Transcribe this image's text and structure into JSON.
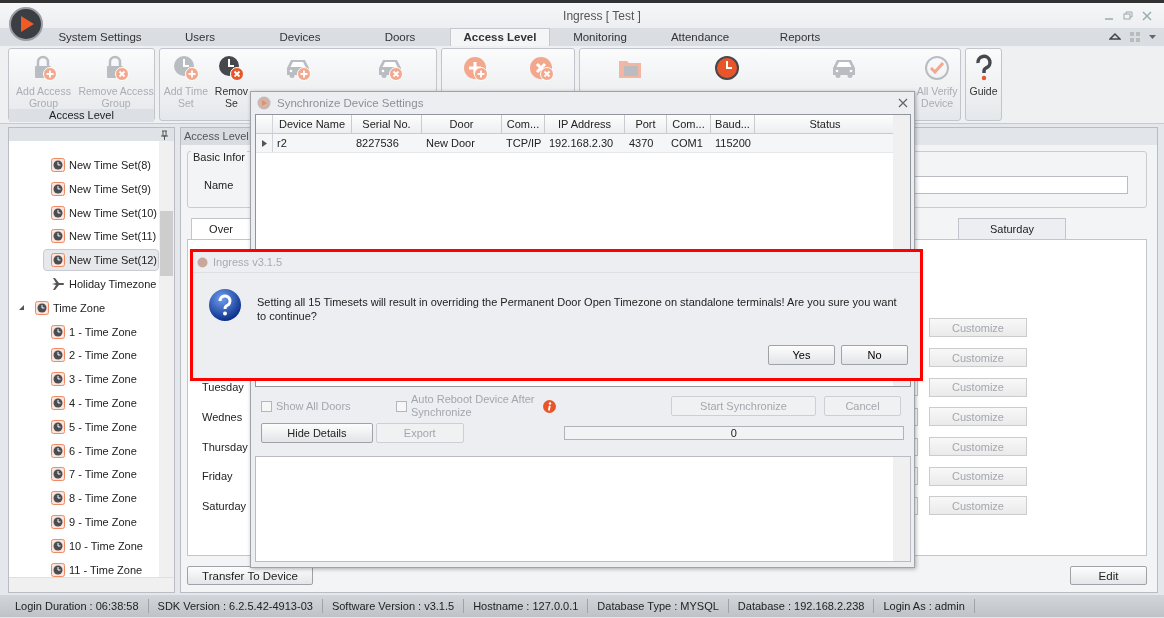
{
  "window": {
    "title": "Ingress [ Test ]"
  },
  "tabs": [
    {
      "label": "System Settings",
      "selected": false
    },
    {
      "label": "Users",
      "selected": false
    },
    {
      "label": "Devices",
      "selected": false
    },
    {
      "label": "Doors",
      "selected": false
    },
    {
      "label": "Access Level",
      "selected": true
    },
    {
      "label": "Monitoring",
      "selected": false
    },
    {
      "label": "Attendance",
      "selected": false
    },
    {
      "label": "Reports",
      "selected": false
    }
  ],
  "ribbon": {
    "groups": [
      {
        "label": "Access Level",
        "buttons": [
          {
            "kind": "addgroup",
            "lines": [
              "Add Access",
              "Group"
            ],
            "disabled": true
          },
          {
            "kind": "removegroup",
            "lines": [
              "Remove Access",
              "Group"
            ],
            "disabled": true
          }
        ]
      },
      {
        "buttons": [
          {
            "kind": "addtimeset",
            "lines": [
              "Add Time",
              "Set"
            ],
            "disabled": true
          },
          {
            "kind": "removetimeset",
            "lines": [
              "Remov",
              "Se"
            ],
            "disabled": false
          },
          {
            "kind": "addholiday",
            "disabled": true
          },
          {
            "kind": "removeholiday",
            "disabled": true
          }
        ]
      },
      {
        "buttons": [
          {
            "kind": "addverify",
            "disabled": true
          },
          {
            "kind": "removeverify",
            "disabled": true
          }
        ]
      },
      {
        "buttons": [
          {
            "kind": "transferholiday",
            "disabled": true
          },
          {
            "kind": "transfertimes",
            "disabled": false
          },
          {
            "kind": "transferholidays",
            "disabled": true
          },
          {
            "kind": "transferverify",
            "lines": [
              "All Verify",
              "Device"
            ],
            "disabled": true
          }
        ]
      },
      {
        "buttons": [
          {
            "kind": "guide",
            "lines": [
              "Guide"
            ],
            "disabled": false
          }
        ]
      }
    ]
  },
  "tree": {
    "items": [
      {
        "kind": "clock",
        "label": "New Time Set(8)",
        "selected": false
      },
      {
        "kind": "clock",
        "label": "New Time Set(9)",
        "selected": false
      },
      {
        "kind": "clock",
        "label": "New Time Set(10)",
        "selected": false
      },
      {
        "kind": "clock",
        "label": "New Time Set(11)",
        "selected": false
      },
      {
        "kind": "clock",
        "label": "New Time Set(12)",
        "selected": true
      },
      {
        "kind": "holiday",
        "label": "Holiday Timezone",
        "selected": false
      },
      {
        "kind": "clock",
        "label": "Time Zone",
        "selected": false,
        "expanded": true,
        "children": [
          {
            "kind": "clock",
            "label": "1 - Time Zone",
            "selected": false
          },
          {
            "kind": "clock",
            "label": "2 - Time Zone",
            "selected": false
          },
          {
            "kind": "clock",
            "label": "3 - Time Zone",
            "selected": false
          },
          {
            "kind": "clock",
            "label": "4 - Time Zone",
            "selected": false
          },
          {
            "kind": "clock",
            "label": "5 - Time Zone",
            "selected": false
          },
          {
            "kind": "clock",
            "label": "6 - Time Zone",
            "selected": false
          },
          {
            "kind": "clock",
            "label": "7 - Time Zone",
            "selected": false
          },
          {
            "kind": "clock",
            "label": "8 - Time Zone",
            "selected": false
          },
          {
            "kind": "clock",
            "label": "9 - Time Zone",
            "selected": false
          },
          {
            "kind": "clock",
            "label": "10 - Time Zone",
            "selected": false
          },
          {
            "kind": "clock",
            "label": "11 - Time Zone",
            "selected": false
          }
        ]
      }
    ]
  },
  "content": {
    "header": "Access Level",
    "legend": "Basic Infor",
    "name_label": "Name",
    "day_tabs": [
      {
        "label": "Over",
        "selected": true
      },
      {
        "label": "Saturday",
        "selected": false
      }
    ],
    "day_rows": [
      {
        "button": "Customize"
      },
      {
        "button": "Customize"
      },
      {
        "label": "Tuesday",
        "button": "Customize"
      },
      {
        "label": "Wednes",
        "button": "Customize"
      },
      {
        "label": "Thursday",
        "button": "Customize"
      },
      {
        "label": "Friday",
        "button": "Customize"
      },
      {
        "label": "Saturday",
        "button": "Customize"
      }
    ],
    "transfer_button": "Transfer To Device",
    "edit_button": "Edit"
  },
  "sync_dialog": {
    "title": "Synchronize Device Settings",
    "columns": [
      "Device Name",
      "Serial No.",
      "Door",
      "Com...",
      "IP Address",
      "Port",
      "Com...",
      "Baud...",
      "Status"
    ],
    "rows": [
      {
        "cells": [
          "r2",
          "8227536",
          "New Door",
          "TCP/IP",
          "192.168.2.30",
          "4370",
          "COM1",
          "115200",
          ""
        ]
      }
    ],
    "show_all_doors": {
      "label": "Show All Doors",
      "checked": false,
      "disabled": true
    },
    "auto_reboot": {
      "label": "Auto Reboot Device After Synchronize",
      "checked": false,
      "disabled": true
    },
    "start_button": {
      "label": "Start Synchronize",
      "disabled": true
    },
    "cancel_button": {
      "label": "Cancel",
      "disabled": true
    },
    "hide_details_button": {
      "label": "Hide Details",
      "disabled": false
    },
    "export_button": {
      "label": "Export",
      "disabled": true
    },
    "progress": {
      "level": 0,
      "text": "0"
    }
  },
  "message_box": {
    "title": "Ingress v3.1.5",
    "text": "Setting all 15 Timesets will result in overriding the Permanent Door Open Timezone on standalone terminals! Are you sure you want to continue?",
    "buttons": [
      "Yes",
      "No"
    ]
  },
  "status_bar": [
    "Login Duration : 06:38:58",
    "SDK Version : 6.2.5.42-4913-03",
    "Software Version : v3.1.5",
    "Hostname : 127.0.0.1",
    "Database Type : MYSQL",
    "Database : 192.168.2.238",
    "Login As : admin"
  ]
}
